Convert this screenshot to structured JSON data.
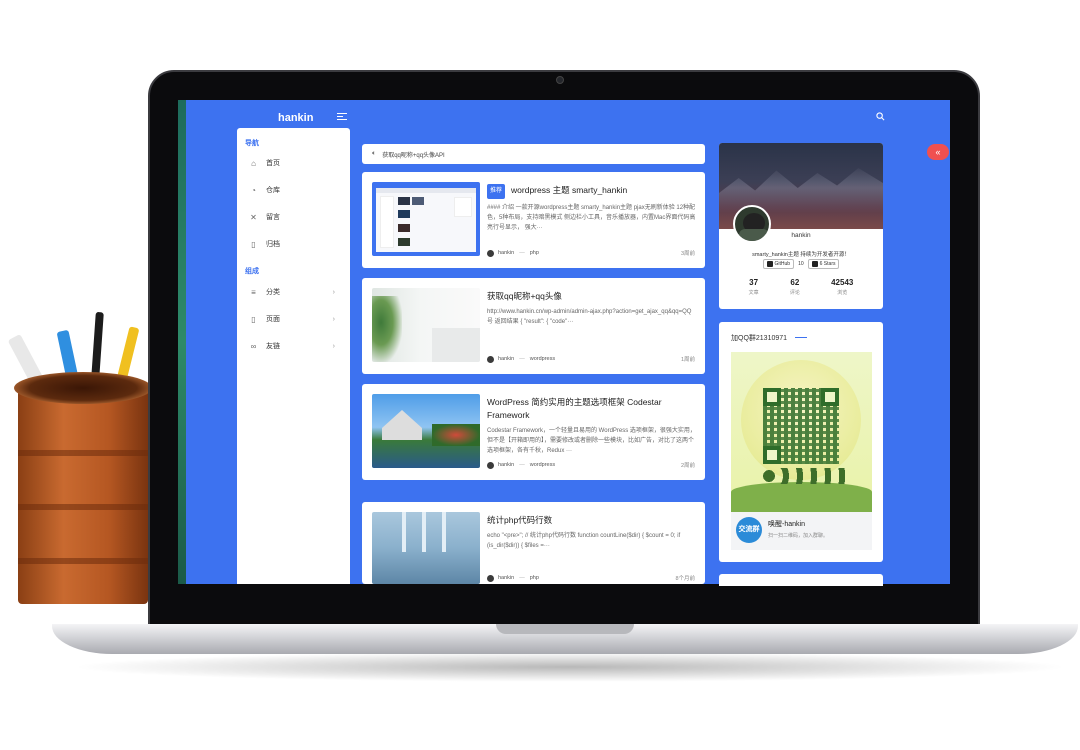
{
  "app": {
    "brand": "hankin"
  },
  "sidebar": {
    "sections": [
      {
        "heading": "导航",
        "items": [
          {
            "label": "首页",
            "icon": "home-icon"
          },
          {
            "label": "仓库",
            "icon": "github-icon"
          },
          {
            "label": "留言",
            "icon": "chat-icon"
          },
          {
            "label": "归档",
            "icon": "archive-icon"
          }
        ]
      },
      {
        "heading": "组成",
        "items": [
          {
            "label": "分类",
            "icon": "category-icon"
          },
          {
            "label": "页面",
            "icon": "page-icon"
          },
          {
            "label": "友链",
            "icon": "link-icon"
          }
        ]
      }
    ]
  },
  "notice": {
    "text": "获取qq昵称+qq头像API"
  },
  "posts": [
    {
      "badge": "推荐",
      "title": "wordpress 主题 smarty_hankin",
      "excerpt": "#### 介绍 一款开源wordpress主题 smarty_hankin主题 pjax无刷新体验 12种配色，5种布局，支持暗黑模式 侧边栏小工具，音乐播放器，内置Mac界面代码高亮行号显示， 强大···",
      "author": "hankin",
      "category": "php",
      "time": "3周前"
    },
    {
      "badge": "",
      "title": "获取qq昵称+qq头像",
      "excerpt": "http://www.hankin.cn/wp-admin/admin-ajax.php?action=get_ajax_qq&qq=QQ号 返回结果 { \"result\": { \"code\"···",
      "author": "hankin",
      "category": "wordpress",
      "time": "1周前"
    },
    {
      "badge": "",
      "title": "WordPress 简约实用的主题选项框架 Codestar Framework",
      "excerpt": "Codestar Framework，一个轻量且易用的 WordPress 选项框架，很强大实用，但不是【开箱即用的】，需要修改或者删除一些模块，比如广告，对比了这两个选项框架，各有千秋，Redux ···",
      "author": "hankin",
      "category": "wordpress",
      "time": "2周前"
    },
    {
      "badge": "",
      "title": "统计php代码行数",
      "excerpt": "echo \"<pre>\"; // 统计php代码行数 function countLine($dir) { $count = 0; if (is_dir($dir)) { $files =···",
      "author": "hankin",
      "category": "php",
      "time": "8个月前"
    }
  ],
  "profile": {
    "name": "hankin",
    "bio": "smarty_hankin主题 持续为开发者开源！",
    "github_label": "GitHub",
    "fork_count": "10",
    "stars_label": "6 Stars",
    "stats": [
      {
        "num": "37",
        "label": "文章"
      },
      {
        "num": "62",
        "label": "评论"
      },
      {
        "num": "42543",
        "label": "浏览"
      }
    ]
  },
  "qr": {
    "title": "加QQ群21310971",
    "group_icon_text": "交流群",
    "group_name": "唤醒-hankin",
    "group_desc": "扫一扫二维码，加入群聊。"
  },
  "colors": {
    "accent": "#3d72f0",
    "fab": "#f05050"
  }
}
